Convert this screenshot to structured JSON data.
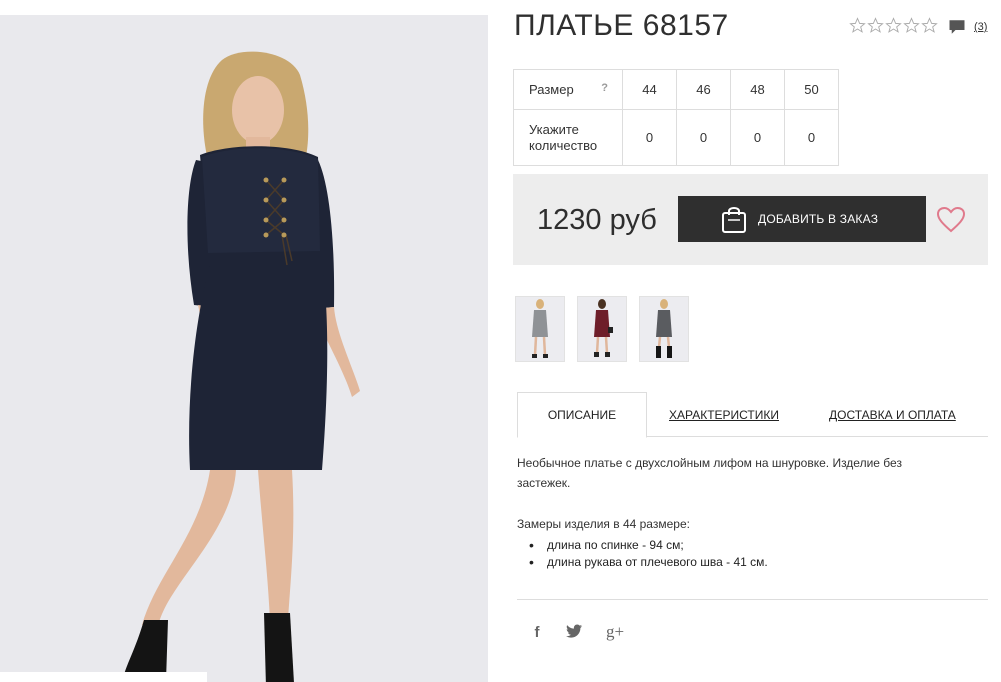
{
  "product": {
    "title": "ПЛАТЬЕ 68157",
    "rating_stars": 0,
    "rating_max": 5,
    "comment_count": "(3)"
  },
  "sizes": {
    "size_label": "Размер",
    "help_mark": "?",
    "qty_label_line1": "Укажите",
    "qty_label_line2": "количество",
    "columns": [
      "44",
      "46",
      "48",
      "50"
    ],
    "quantities": [
      "0",
      "0",
      "0",
      "0"
    ]
  },
  "purchase": {
    "price": "1230 руб",
    "order_button": "ДОБАВИТЬ В ЗАКАЗ"
  },
  "thumbnails": [
    {
      "name": "grey-dress",
      "color": "#8f9296"
    },
    {
      "name": "burgundy-dress",
      "color": "#6e1e2a"
    },
    {
      "name": "grey-dress-boots",
      "color": "#5a5c60"
    }
  ],
  "tabs": [
    {
      "label": "ОПИСАНИЕ",
      "active": true
    },
    {
      "label": "ХАРАКТЕРИСТИКИ",
      "active": false
    },
    {
      "label": "ДОСТАВКА И ОПЛАТА",
      "active": false
    }
  ],
  "description": {
    "text": "Необычное платье с двухслойным лифом на шнуровке. Изделие без застежек.",
    "measure_title": "Замеры изделия в 44 размере:",
    "measures": [
      "длина по спинке - 94 см;",
      "длина рукава от плечевого шва - 41 см."
    ]
  },
  "social": {
    "facebook_glyph": "f",
    "twitter_icon": "twitter-icon",
    "googleplus_glyph": "g+"
  },
  "colors": {
    "dress": "#1e2436",
    "button_bg": "#2f2f2f",
    "price_bg": "#ededed",
    "heart": "#e07a8c"
  }
}
